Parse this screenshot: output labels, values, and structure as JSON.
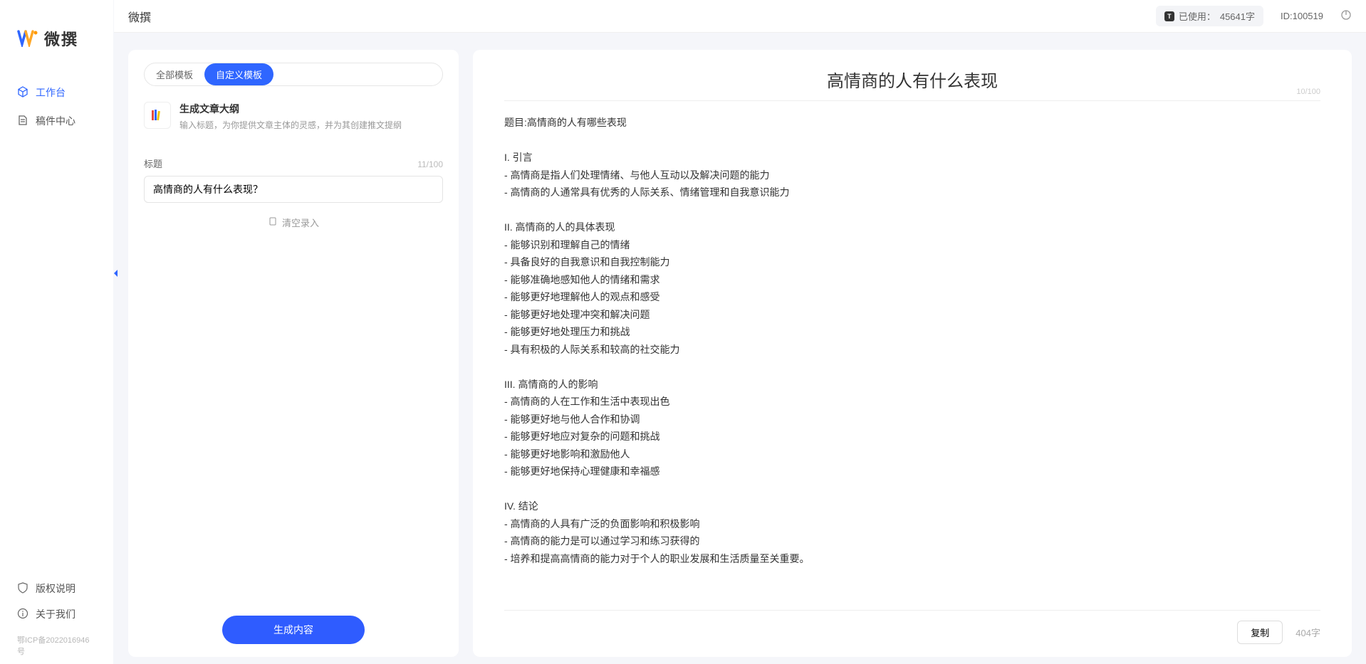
{
  "app": {
    "name": "微撰",
    "logo_text": "微撰"
  },
  "topbar": {
    "title": "微撰",
    "usage_label": "已使用：",
    "usage_value": "45641字",
    "id_label": "ID:100519"
  },
  "sidebar": {
    "items": [
      {
        "label": "工作台",
        "active": true
      },
      {
        "label": "稿件中心",
        "active": false
      }
    ],
    "bottom": [
      {
        "label": "版权说明"
      },
      {
        "label": "关于我们"
      }
    ],
    "icp": "鄂ICP备2022016946号"
  },
  "tabs": [
    {
      "label": "全部模板",
      "active": false
    },
    {
      "label": "自定义模板",
      "active": true
    }
  ],
  "template": {
    "title": "生成文章大纲",
    "desc": "输入标题，为你提供文章主体的灵感，并为其创建推文提纲"
  },
  "form": {
    "title_label": "标题",
    "title_counter": "11/100",
    "title_value": "高情商的人有什么表现？",
    "record_label": "清空录入",
    "generate_btn": "生成内容"
  },
  "output": {
    "title": "高情商的人有什么表现",
    "title_counter": "10/100",
    "body": "题目:高情商的人有哪些表现\n\nI. 引言\n- 高情商是指人们处理情绪、与他人互动以及解决问题的能力\n- 高情商的人通常具有优秀的人际关系、情绪管理和自我意识能力\n\nII. 高情商的人的具体表现\n- 能够识别和理解自己的情绪\n- 具备良好的自我意识和自我控制能力\n- 能够准确地感知他人的情绪和需求\n- 能够更好地理解他人的观点和感受\n- 能够更好地处理冲突和解决问题\n- 能够更好地处理压力和挑战\n- 具有积极的人际关系和较高的社交能力\n\nIII. 高情商的人的影响\n- 高情商的人在工作和生活中表现出色\n- 能够更好地与他人合作和协调\n- 能够更好地应对复杂的问题和挑战\n- 能够更好地影响和激励他人\n- 能够更好地保持心理健康和幸福感\n\nIV. 结论\n- 高情商的人具有广泛的负面影响和积极影响\n- 高情商的能力是可以通过学习和练习获得的\n- 培养和提高高情商的能力对于个人的职业发展和生活质量至关重要。",
    "copy_btn": "复制",
    "char_count": "404字"
  }
}
